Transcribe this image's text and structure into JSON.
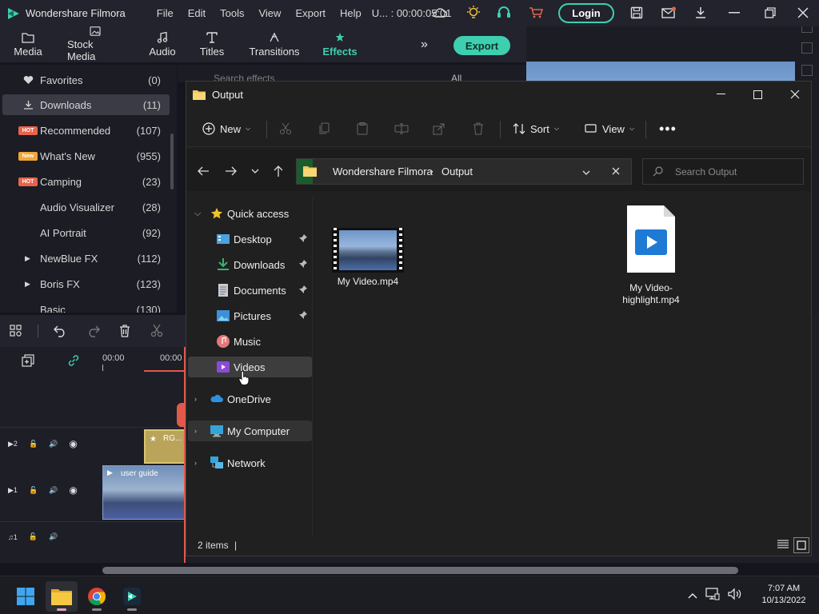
{
  "filmora": {
    "app_name": "Wondershare Filmora",
    "menu": [
      "File",
      "Edit",
      "Tools",
      "View",
      "Export",
      "Help"
    ],
    "timecode": "U... : 00:00:05:01",
    "login_label": "Login",
    "tabs": [
      {
        "label": "Media",
        "icon": "folder-icon"
      },
      {
        "label": "Stock Media",
        "icon": "stock-media-icon"
      },
      {
        "label": "Audio",
        "icon": "music-note-icon"
      },
      {
        "label": "Titles",
        "icon": "text-t-icon"
      },
      {
        "label": "Transitions",
        "icon": "transitions-icon"
      },
      {
        "label": "Effects",
        "icon": "effects-icon",
        "active": true
      }
    ],
    "export_label": "Export",
    "search_placeholder": "Search effects",
    "filter_value": "All",
    "categories": [
      {
        "label": "Favorites",
        "count": "(0)",
        "icon": "heart-icon"
      },
      {
        "label": "Downloads",
        "count": "(11)",
        "icon": "download-icon",
        "active": true
      },
      {
        "label": "Recommended",
        "count": "(107)",
        "badge": "HOT"
      },
      {
        "label": "What's New",
        "count": "(955)",
        "badge": "New"
      },
      {
        "label": "Camping",
        "count": "(23)",
        "badge": "HOT"
      },
      {
        "label": "Audio Visualizer",
        "count": "(28)"
      },
      {
        "label": "AI Portrait",
        "count": "(92)"
      },
      {
        "label": "NewBlue FX",
        "count": "(112)",
        "expandable": true
      },
      {
        "label": "Boris FX",
        "count": "(123)",
        "expandable": true
      },
      {
        "label": "Basic",
        "count": "(130)"
      }
    ],
    "timeline": {
      "ruler_labels": [
        "00:00",
        "00:00"
      ],
      "track_v2_label": "2",
      "track_v1_label": "1",
      "track_a1_label": "1",
      "clip_title": "RG...",
      "clip_video": "user guide"
    }
  },
  "explorer": {
    "title": "Output",
    "commands": {
      "new": "New",
      "sort": "Sort",
      "view": "View"
    },
    "breadcrumb": [
      "Wondershare Filmora",
      "Output"
    ],
    "search_placeholder": "Search Output",
    "tree": [
      {
        "label": "Quick access",
        "icon": "star-icon",
        "expandable": true,
        "expanded": true
      },
      {
        "label": "Desktop",
        "icon": "desktop-icon",
        "pinned": true
      },
      {
        "label": "Downloads",
        "icon": "download-icon",
        "pinned": true
      },
      {
        "label": "Documents",
        "icon": "document-icon",
        "pinned": true
      },
      {
        "label": "Pictures",
        "icon": "pictures-icon",
        "pinned": true
      },
      {
        "label": "Music",
        "icon": "music-icon"
      },
      {
        "label": "Videos",
        "icon": "videos-icon",
        "selected": true
      },
      {
        "label": "OneDrive",
        "icon": "cloud-icon",
        "expandable": true
      },
      {
        "label": "My Computer",
        "icon": "computer-icon",
        "expandable": true
      },
      {
        "label": "Network",
        "icon": "network-icon",
        "expandable": true
      }
    ],
    "files": [
      {
        "name": "My Video.mp4",
        "type": "video-thumbnail"
      },
      {
        "name": "My Video-highlight.mp4",
        "type": "video-file-icon"
      }
    ],
    "status": "2 items"
  },
  "taskbar": {
    "apps": [
      "start-icon",
      "file-explorer-icon",
      "chrome-icon",
      "filmora-icon"
    ],
    "time": "7:07 AM",
    "date": "10/13/2022"
  },
  "colors": {
    "accent": "#3ecfb0",
    "explorer_bg": "#202020",
    "filmora_bg": "#1b1c24"
  }
}
